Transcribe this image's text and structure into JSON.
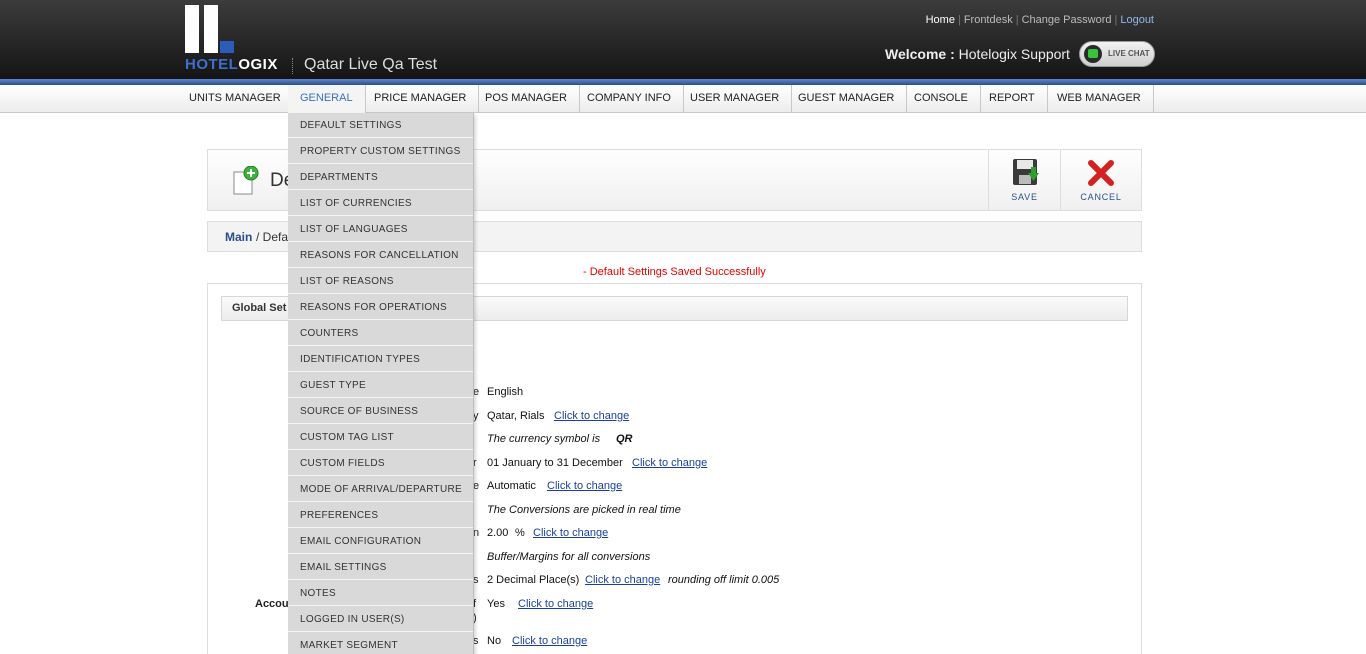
{
  "brand": {
    "logo_hotel": "HOTEL",
    "logo_ogix": "OGIX",
    "hotel_name": "Qatar Live Qa Test"
  },
  "header": {
    "links": [
      "Home",
      "Frontdesk",
      "Change Password",
      "Logout"
    ],
    "welcome_label": "Welcome :",
    "welcome_user": "Hotelogix Support",
    "live_chat": "LIVE CHAT"
  },
  "nav": [
    "UNITS MANAGER",
    "GENERAL",
    "PRICE MANAGER",
    "POS MANAGER",
    "COMPANY INFO",
    "USER MANAGER",
    "GUEST MANAGER",
    "CONSOLE",
    "REPORT",
    "WEB MANAGER"
  ],
  "nav_active": "GENERAL",
  "dropdown": [
    "DEFAULT SETTINGS",
    "PROPERTY CUSTOM SETTINGS",
    "DEPARTMENTS",
    "LIST OF CURRENCIES",
    "LIST OF LANGUAGES",
    "REASONS FOR CANCELLATION",
    "LIST OF REASONS",
    "REASONS FOR OPERATIONS",
    "COUNTERS",
    "IDENTIFICATION TYPES",
    "GUEST TYPE",
    "SOURCE OF BUSINESS",
    "CUSTOM TAG LIST",
    "CUSTOM FIELDS",
    "MODE OF ARRIVAL/DEPARTURE",
    "PREFERENCES",
    "EMAIL CONFIGURATION",
    "EMAIL SETTINGS",
    "NOTES",
    "LOGGED IN USER(S)",
    "MARKET SEGMENT"
  ],
  "page": {
    "title_fragment": "De",
    "save_label": "SAVE",
    "cancel_label": "CANCEL",
    "breadcrumb_main": "Main",
    "breadcrumb_rest": "/ Defa",
    "success_message": "- Default Settings Saved Successfully",
    "section_title": "Global Set"
  },
  "settings": {
    "frag_e1": "e",
    "language": "English",
    "frag_y": "y",
    "currency": "Qatar, Rials",
    "currency_symbol_text": "The currency symbol is",
    "currency_symbol": "QR",
    "frag_r": "r",
    "financial_year": "01 January to 31 December",
    "frag_e2": "e",
    "conversion_mode": "Automatic",
    "conversion_note": "The Conversions are picked in real time",
    "frag_n": "n",
    "buffer_value": "2.00",
    "buffer_unit": "%",
    "buffer_note": "Buffer/Margins for all conversions",
    "frag_s1": "s",
    "decimal_places": "2 Decimal Place(s)",
    "rounding_note": "rounding off limit 0.005",
    "accou_label": "Accou",
    "frag_f": "f",
    "frag_paren": ")",
    "accounting_value": "Yes",
    "frag_s2": "s",
    "last_value": "No",
    "click_to_change": "Click to change"
  },
  "colors": {
    "accent": "#3a6fc6",
    "link": "#1a3fa0",
    "success": "#e60000"
  }
}
